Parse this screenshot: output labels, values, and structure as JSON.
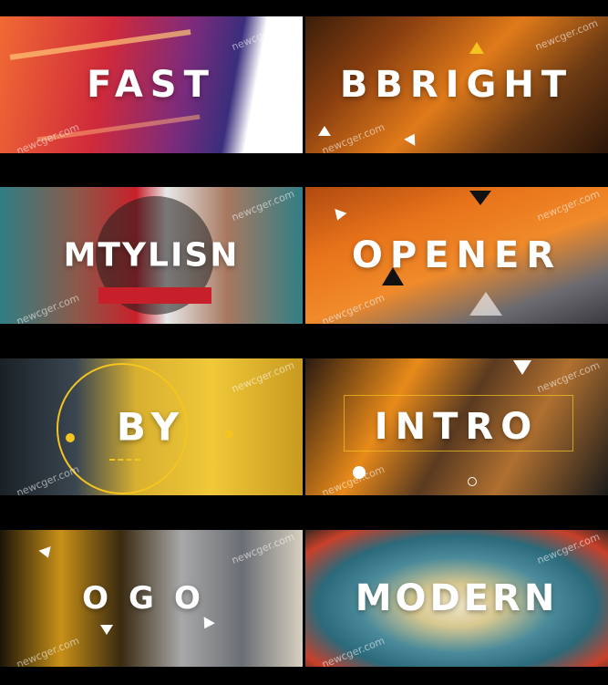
{
  "grid": {
    "tiles": [
      {
        "word": "FAST",
        "watermarks": [
          "newcger.com",
          "newcger.com"
        ]
      },
      {
        "word": "BRIGHT",
        "prefix": "B",
        "watermarks": [
          "newcger.com",
          "newcger.com"
        ]
      },
      {
        "word": "MTYLISN",
        "watermarks": [
          "newcger.com",
          "newcger.com"
        ]
      },
      {
        "word": "OPENER",
        "watermarks": [
          "newcger.com",
          "newcger.com"
        ]
      },
      {
        "word": "BY",
        "watermarks": [
          "newcger.com",
          "newcger.com"
        ]
      },
      {
        "word": "INTRO",
        "watermarks": [
          "newcger.com",
          "newcger.com"
        ]
      },
      {
        "word": "OGO",
        "watermarks": [
          "newcger.com",
          "newcger.com"
        ]
      },
      {
        "word": "MODERN",
        "watermarks": [
          "newcger.com",
          "newcger.com"
        ]
      }
    ]
  },
  "colors": {
    "background": "#000000",
    "text": "#ffffff",
    "accent_yellow": "#f4c520",
    "accent_orange": "#e8731a",
    "accent_teal": "#2f7f86",
    "accent_red": "#c8202a"
  }
}
